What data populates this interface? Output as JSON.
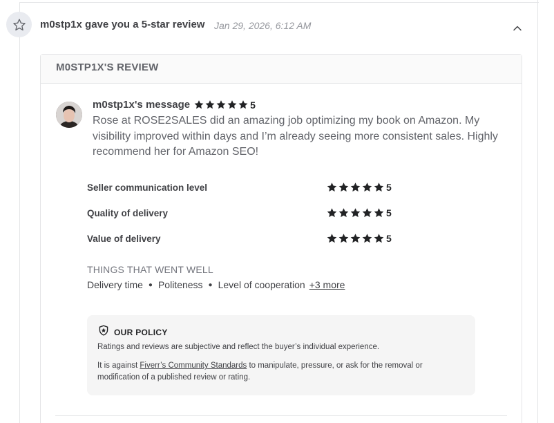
{
  "header": {
    "title": "m0stp1x gave you a 5-star review",
    "date": "Jan 29, 2026, 6:12 AM",
    "star_icon": "star-outline-icon",
    "toggle_icon": "chevron-up-icon"
  },
  "review": {
    "heading": "M0STP1X'S REVIEW",
    "author_message_label": "m0stp1x's message",
    "overall_rating": "5",
    "overall_stars": 5,
    "message": "Rose at ROSE2SALES did an amazing job optimizing my book on Amazon. My visibility improved within days and I’m already seeing more consistent sales. Highly recommend her for Amazon SEO!"
  },
  "breakdown": [
    {
      "label": "Seller communication level",
      "rating": "5",
      "stars": 5
    },
    {
      "label": "Quality of delivery",
      "rating": "5",
      "stars": 5
    },
    {
      "label": "Value of delivery",
      "rating": "5",
      "stars": 5
    }
  ],
  "went_well": {
    "title": "THINGS THAT WENT WELL",
    "items": [
      "Delivery time",
      "Politeness",
      "Level of cooperation"
    ],
    "more": "+3 more"
  },
  "policy": {
    "title": "OUR POLICY",
    "icon": "shield-star-icon",
    "p1": "Ratings and reviews are subjective and reflect the buyer’s individual experience.",
    "p2_before": "It is against ",
    "p2_link": "Fiverr’s Community Standards",
    "p2_after": " to manipulate, pressure, or ask for the removal or modification of a published review or rating."
  },
  "colors": {
    "star": "#222325",
    "text_primary": "#404145",
    "text_muted": "#95979d",
    "border": "#e4e5e7",
    "policy_bg": "#f5f5f5"
  }
}
